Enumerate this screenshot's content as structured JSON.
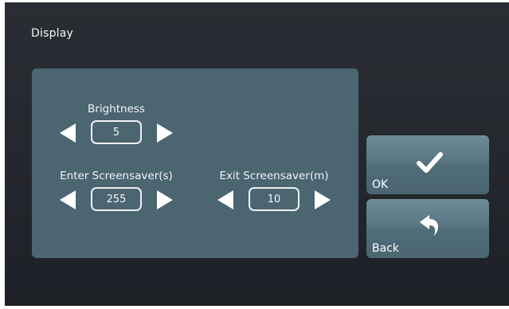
{
  "page": {
    "title": "Display"
  },
  "settings": {
    "brightness": {
      "label": "Brightness",
      "value": "5"
    },
    "enter_screensaver": {
      "label": "Enter Screensaver(s)",
      "value": "255"
    },
    "exit_screensaver": {
      "label": "Exit Screensaver(m)",
      "value": "10"
    }
  },
  "buttons": {
    "ok": {
      "label": "OK",
      "icon": "checkmark-icon"
    },
    "back": {
      "label": "Back",
      "icon": "back-arrow-icon"
    }
  },
  "colors": {
    "background": "#24272d",
    "panel": "#4b6571",
    "button": "#5d7a86",
    "text": "#f2f4f6"
  }
}
